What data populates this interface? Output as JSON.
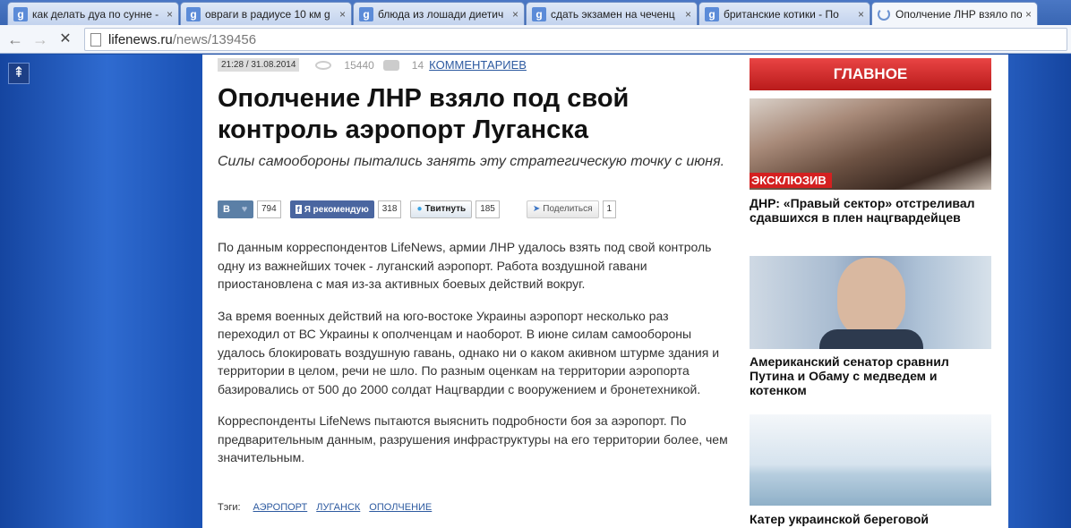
{
  "browser": {
    "tabs": [
      {
        "title": "как делать дуа по сунне -",
        "active": false
      },
      {
        "title": "овраги в радиусе 10 км g",
        "active": false
      },
      {
        "title": "блюда из лошади диетич",
        "active": false
      },
      {
        "title": "сдать экзамен на чеченц",
        "active": false
      },
      {
        "title": "британские котики - По",
        "active": false
      },
      {
        "title": "Ополчение ЛНР взяло по",
        "active": true
      }
    ],
    "tab_icon_letter": "g",
    "close_glyph": "×",
    "back_glyph": "←",
    "forward_glyph": "→",
    "reload_glyph": "✕",
    "url_host": "lifenews.ru",
    "url_path": "/news/139456"
  },
  "page": {
    "to_top_glyph": "⇞",
    "meta": {
      "datetime": "21:28 / 31.08.2014",
      "views": "15440",
      "comments_count": "14",
      "comments_label": "КОММЕНТАРИЕВ"
    },
    "headline": "Ополчение ЛНР взяло под свой контроль аэропорт Луганска",
    "subheadline": "Силы самообороны пытались занять эту стратегическую точку с июня.",
    "share": {
      "vk_label": "В",
      "vk_heart": "♥",
      "vk_count": "794",
      "fb_label": "Я рекомендую",
      "fb_count": "318",
      "tw_label": "Твитнуть",
      "tw_count": "185",
      "ya_label": "Поделиться",
      "ya_count": "1"
    },
    "paragraphs": [
      "По данным корреспондентов LifeNews, армии ЛНР удалось взять под свой контроль одну из важнейших точек - луганский аэропорт. Работа воздушной гавани приостановлена с мая из-за активных боевых действий вокруг.",
      "За время военных действий на юго-востоке Украины аэропорт несколько раз переходил от ВС Украины к ополченцам и наоборот. В июне силам самообороны удалось блокировать воздушную гавань, однако ни о каком акивном штурме здания и территории в целом, речи не шло. По разным оценкам на территории аэропорта базировались от 500 до 2000 солдат Нацгвардии с вооружением и бронетехникой.",
      "Корреспонденты LifeNews пытаются выяснить подробности боя за аэропорт. По предварительным данным, разрушения инфраструктуры на его территории более, чем значительным."
    ],
    "tags_label": "Тэги:",
    "tags": [
      "АЭРОПОРТ",
      "ЛУГАНСК",
      "ОПОЛЧЕНИЕ"
    ]
  },
  "sidebar": {
    "header": "ГЛАВНОЕ",
    "items": [
      {
        "badge": "ЭКСКЛЮЗИВ",
        "caption": "ДНР: «Правый сектор» отстреливал сдавшихся в плен нацгвардейцев"
      },
      {
        "caption": "Американский сенатор сравнил Путина и Обаму с медведем и котенком"
      },
      {
        "caption": "Катер украинской береговой"
      }
    ]
  }
}
